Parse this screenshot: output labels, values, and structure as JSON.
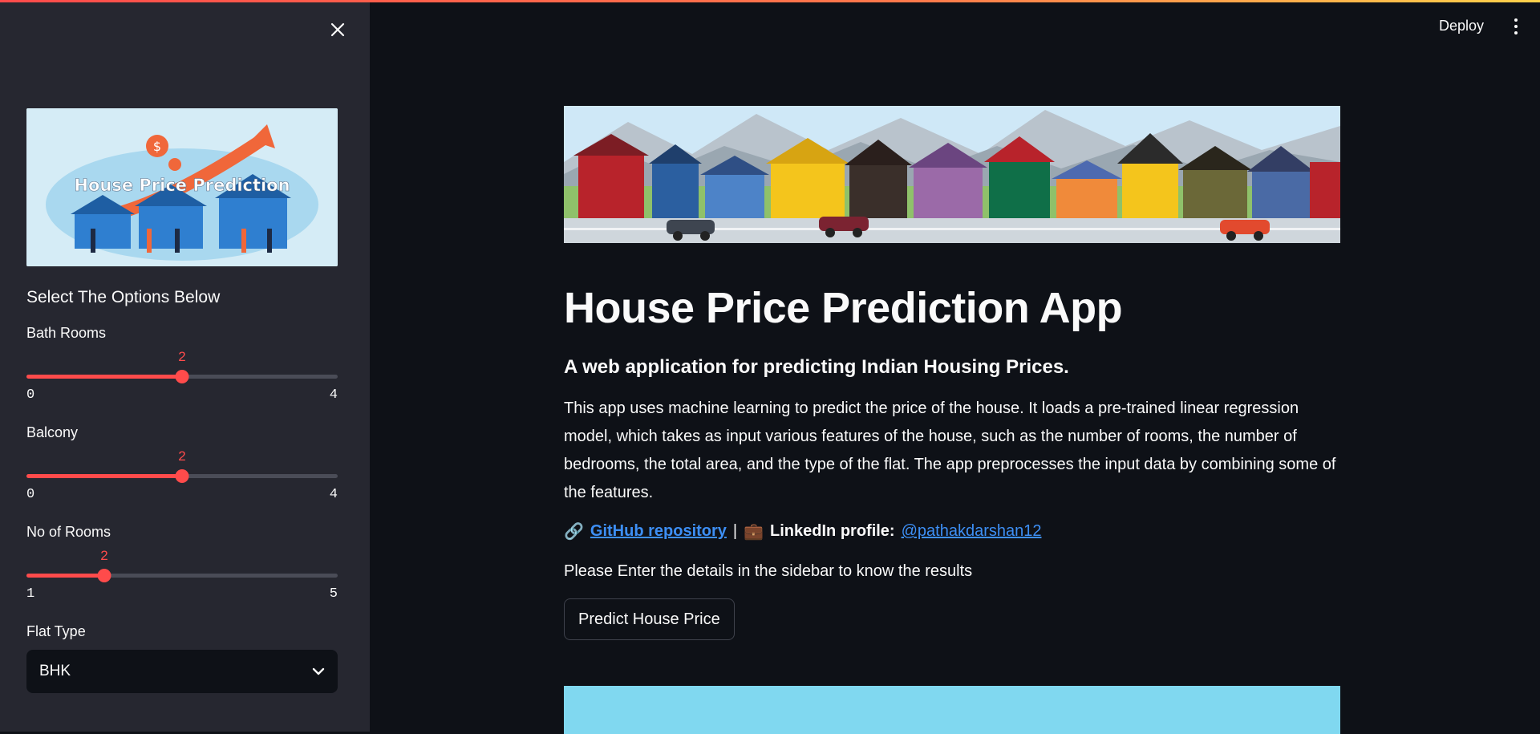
{
  "header": {
    "deploy_label": "Deploy",
    "menu_icon": "kebab-menu-icon"
  },
  "sidebar": {
    "close_icon": "close-icon",
    "banner_title": "House Price Prediction",
    "heading": "Select The Options Below",
    "sliders": [
      {
        "label": "Bath Rooms",
        "value": "2",
        "min": "0",
        "max": "4",
        "fraction": 0.5
      },
      {
        "label": "Balcony",
        "value": "2",
        "min": "0",
        "max": "4",
        "fraction": 0.5
      },
      {
        "label": "No of Rooms",
        "value": "2",
        "min": "1",
        "max": "5",
        "fraction": 0.25
      }
    ],
    "flat_type": {
      "label": "Flat Type",
      "value": "BHK"
    }
  },
  "main": {
    "title": "House Price Prediction App",
    "subtitle": "A web application for predicting Indian Housing Prices.",
    "description": "This app uses machine learning to predict the price of the house. It loads a pre-trained linear regression model, which takes as input various features of the house, such as the number of rooms, the number of bedrooms, the total area, and the type of the flat. The app preprocesses the input data by combining some of the features.",
    "links": {
      "github_icon": "🔗",
      "github_label": "GitHub repository",
      "separator": "|",
      "linkedin_icon": "💼",
      "linkedin_prefix": "LinkedIn profile:",
      "linkedin_handle": "@pathakdarshan12"
    },
    "instruction": "Please Enter the details in the sidebar to know the results",
    "predict_button": "Predict House Price"
  },
  "colors": {
    "accent": "#ff4b4b",
    "link": "#3d8ff5",
    "background": "#0e1117",
    "sidebar": "#262730"
  }
}
